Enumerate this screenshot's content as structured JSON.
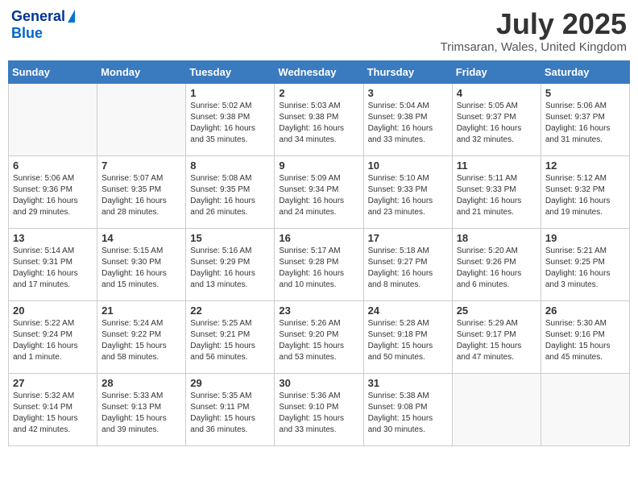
{
  "header": {
    "logo_line1": "General",
    "logo_line2": "Blue",
    "title": "July 2025",
    "location": "Trimsaran, Wales, United Kingdom"
  },
  "calendar": {
    "days_of_week": [
      "Sunday",
      "Monday",
      "Tuesday",
      "Wednesday",
      "Thursday",
      "Friday",
      "Saturday"
    ],
    "weeks": [
      [
        {
          "day": "",
          "info": ""
        },
        {
          "day": "",
          "info": ""
        },
        {
          "day": "1",
          "info": "Sunrise: 5:02 AM\nSunset: 9:38 PM\nDaylight: 16 hours\nand 35 minutes."
        },
        {
          "day": "2",
          "info": "Sunrise: 5:03 AM\nSunset: 9:38 PM\nDaylight: 16 hours\nand 34 minutes."
        },
        {
          "day": "3",
          "info": "Sunrise: 5:04 AM\nSunset: 9:38 PM\nDaylight: 16 hours\nand 33 minutes."
        },
        {
          "day": "4",
          "info": "Sunrise: 5:05 AM\nSunset: 9:37 PM\nDaylight: 16 hours\nand 32 minutes."
        },
        {
          "day": "5",
          "info": "Sunrise: 5:06 AM\nSunset: 9:37 PM\nDaylight: 16 hours\nand 31 minutes."
        }
      ],
      [
        {
          "day": "6",
          "info": "Sunrise: 5:06 AM\nSunset: 9:36 PM\nDaylight: 16 hours\nand 29 minutes."
        },
        {
          "day": "7",
          "info": "Sunrise: 5:07 AM\nSunset: 9:35 PM\nDaylight: 16 hours\nand 28 minutes."
        },
        {
          "day": "8",
          "info": "Sunrise: 5:08 AM\nSunset: 9:35 PM\nDaylight: 16 hours\nand 26 minutes."
        },
        {
          "day": "9",
          "info": "Sunrise: 5:09 AM\nSunset: 9:34 PM\nDaylight: 16 hours\nand 24 minutes."
        },
        {
          "day": "10",
          "info": "Sunrise: 5:10 AM\nSunset: 9:33 PM\nDaylight: 16 hours\nand 23 minutes."
        },
        {
          "day": "11",
          "info": "Sunrise: 5:11 AM\nSunset: 9:33 PM\nDaylight: 16 hours\nand 21 minutes."
        },
        {
          "day": "12",
          "info": "Sunrise: 5:12 AM\nSunset: 9:32 PM\nDaylight: 16 hours\nand 19 minutes."
        }
      ],
      [
        {
          "day": "13",
          "info": "Sunrise: 5:14 AM\nSunset: 9:31 PM\nDaylight: 16 hours\nand 17 minutes."
        },
        {
          "day": "14",
          "info": "Sunrise: 5:15 AM\nSunset: 9:30 PM\nDaylight: 16 hours\nand 15 minutes."
        },
        {
          "day": "15",
          "info": "Sunrise: 5:16 AM\nSunset: 9:29 PM\nDaylight: 16 hours\nand 13 minutes."
        },
        {
          "day": "16",
          "info": "Sunrise: 5:17 AM\nSunset: 9:28 PM\nDaylight: 16 hours\nand 10 minutes."
        },
        {
          "day": "17",
          "info": "Sunrise: 5:18 AM\nSunset: 9:27 PM\nDaylight: 16 hours\nand 8 minutes."
        },
        {
          "day": "18",
          "info": "Sunrise: 5:20 AM\nSunset: 9:26 PM\nDaylight: 16 hours\nand 6 minutes."
        },
        {
          "day": "19",
          "info": "Sunrise: 5:21 AM\nSunset: 9:25 PM\nDaylight: 16 hours\nand 3 minutes."
        }
      ],
      [
        {
          "day": "20",
          "info": "Sunrise: 5:22 AM\nSunset: 9:24 PM\nDaylight: 16 hours\nand 1 minute."
        },
        {
          "day": "21",
          "info": "Sunrise: 5:24 AM\nSunset: 9:22 PM\nDaylight: 15 hours\nand 58 minutes."
        },
        {
          "day": "22",
          "info": "Sunrise: 5:25 AM\nSunset: 9:21 PM\nDaylight: 15 hours\nand 56 minutes."
        },
        {
          "day": "23",
          "info": "Sunrise: 5:26 AM\nSunset: 9:20 PM\nDaylight: 15 hours\nand 53 minutes."
        },
        {
          "day": "24",
          "info": "Sunrise: 5:28 AM\nSunset: 9:18 PM\nDaylight: 15 hours\nand 50 minutes."
        },
        {
          "day": "25",
          "info": "Sunrise: 5:29 AM\nSunset: 9:17 PM\nDaylight: 15 hours\nand 47 minutes."
        },
        {
          "day": "26",
          "info": "Sunrise: 5:30 AM\nSunset: 9:16 PM\nDaylight: 15 hours\nand 45 minutes."
        }
      ],
      [
        {
          "day": "27",
          "info": "Sunrise: 5:32 AM\nSunset: 9:14 PM\nDaylight: 15 hours\nand 42 minutes."
        },
        {
          "day": "28",
          "info": "Sunrise: 5:33 AM\nSunset: 9:13 PM\nDaylight: 15 hours\nand 39 minutes."
        },
        {
          "day": "29",
          "info": "Sunrise: 5:35 AM\nSunset: 9:11 PM\nDaylight: 15 hours\nand 36 minutes."
        },
        {
          "day": "30",
          "info": "Sunrise: 5:36 AM\nSunset: 9:10 PM\nDaylight: 15 hours\nand 33 minutes."
        },
        {
          "day": "31",
          "info": "Sunrise: 5:38 AM\nSunset: 9:08 PM\nDaylight: 15 hours\nand 30 minutes."
        },
        {
          "day": "",
          "info": ""
        },
        {
          "day": "",
          "info": ""
        }
      ]
    ]
  }
}
